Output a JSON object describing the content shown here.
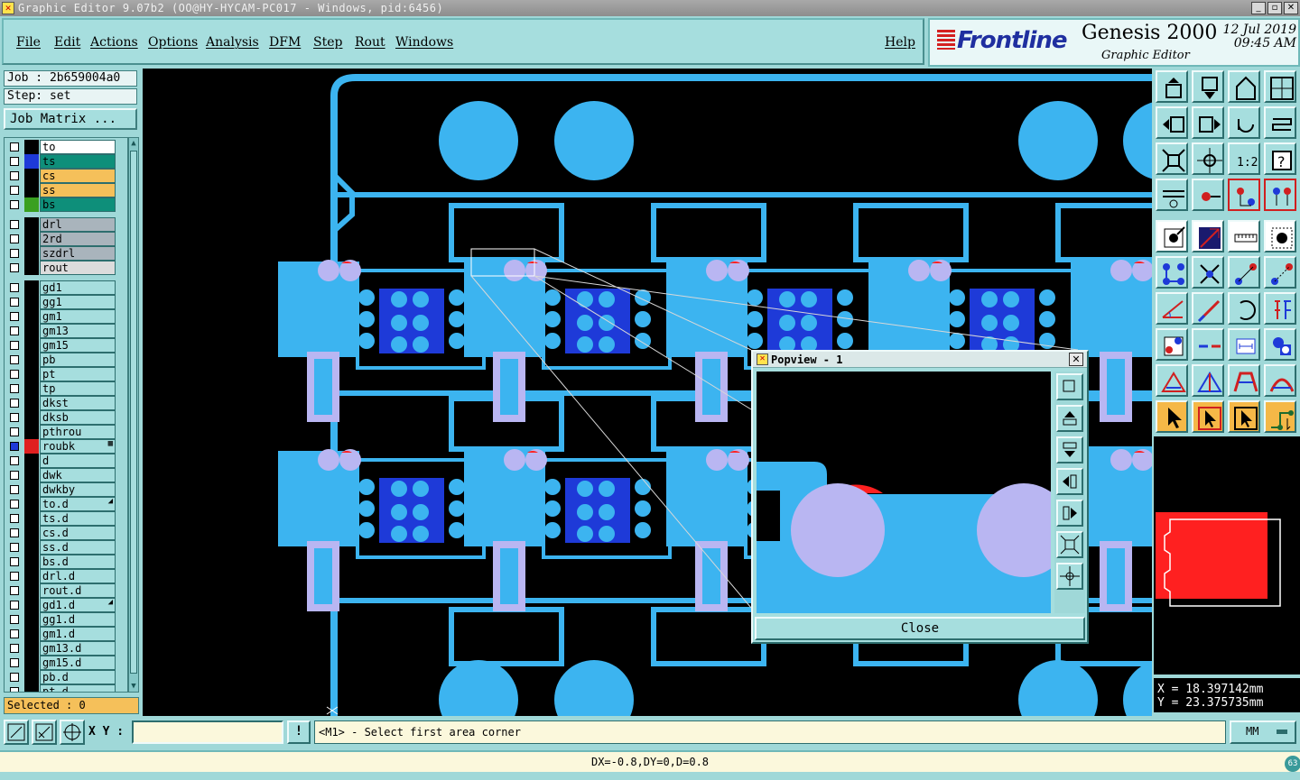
{
  "window": {
    "title": "Graphic Editor 9.07b2 (OO@HY-HYCAM-PC017 - Windows, pid:6456)"
  },
  "menu": {
    "file": "File",
    "edit": "Edit",
    "actions": "Actions",
    "options": "Options",
    "analysis": "Analysis",
    "dfm": "DFM",
    "step": "Step",
    "rout": "Rout",
    "windows": "Windows",
    "help": "Help"
  },
  "brand": {
    "logo": "Frontline",
    "product": "Genesis 2000",
    "subtitle": "Graphic Editor",
    "date": "12 Jul 2019",
    "time": "09:45 AM"
  },
  "job": {
    "job_label": "Job : 2b659004a0",
    "step_label": "Step: set",
    "matrix_button": "Job Matrix ..."
  },
  "layers": [
    {
      "name": "to",
      "color": "#ffffff",
      "swatch": "#000000"
    },
    {
      "name": "ts",
      "color": "#0e8f7a",
      "swatch": "#1e3ad8"
    },
    {
      "name": "cs",
      "color": "#f5c05a",
      "swatch": "#000000"
    },
    {
      "name": "ss",
      "color": "#f5c05a",
      "swatch": "#000000"
    },
    {
      "name": "bs",
      "color": "#0e8f7a",
      "swatch": "#3aa020"
    },
    {
      "name": "drl",
      "color": "#a9b4bc",
      "swatch": "#000000"
    },
    {
      "name": "2rd",
      "color": "#a9b4bc",
      "swatch": "#000000"
    },
    {
      "name": "szdrl",
      "color": "#a9b4bc",
      "swatch": "#000000"
    },
    {
      "name": "rout",
      "color": "#dcdcdc",
      "swatch": "#000000"
    },
    {
      "name": "gd1",
      "color": "#a6dede",
      "swatch": "#000000"
    },
    {
      "name": "gg1",
      "color": "#a6dede",
      "swatch": "#000000"
    },
    {
      "name": "gm1",
      "color": "#a6dede",
      "swatch": "#000000"
    },
    {
      "name": "gm13",
      "color": "#a6dede",
      "swatch": "#000000"
    },
    {
      "name": "gm15",
      "color": "#a6dede",
      "swatch": "#000000"
    },
    {
      "name": "pb",
      "color": "#a6dede",
      "swatch": "#000000"
    },
    {
      "name": "pt",
      "color": "#a6dede",
      "swatch": "#000000"
    },
    {
      "name": "tp",
      "color": "#a6dede",
      "swatch": "#000000"
    },
    {
      "name": "dkst",
      "color": "#a6dede",
      "swatch": "#000000"
    },
    {
      "name": "dksb",
      "color": "#a6dede",
      "swatch": "#000000"
    },
    {
      "name": "pthrou",
      "color": "#a6dede",
      "swatch": "#000000"
    },
    {
      "name": "roubk",
      "color": "#a6dede",
      "swatch": "#e02020",
      "active": true,
      "mark": "▦"
    },
    {
      "name": "d",
      "color": "#a6dede",
      "swatch": "#000000"
    },
    {
      "name": "dwk",
      "color": "#a6dede",
      "swatch": "#000000"
    },
    {
      "name": "dwkby",
      "color": "#a6dede",
      "swatch": "#000000"
    },
    {
      "name": "to.d",
      "color": "#a6dede",
      "swatch": "#000000",
      "mark": "◢"
    },
    {
      "name": "ts.d",
      "color": "#a6dede",
      "swatch": "#000000"
    },
    {
      "name": "cs.d",
      "color": "#a6dede",
      "swatch": "#000000"
    },
    {
      "name": "ss.d",
      "color": "#a6dede",
      "swatch": "#000000"
    },
    {
      "name": "bs.d",
      "color": "#a6dede",
      "swatch": "#000000"
    },
    {
      "name": "drl.d",
      "color": "#a6dede",
      "swatch": "#000000"
    },
    {
      "name": "rout.d",
      "color": "#a6dede",
      "swatch": "#000000"
    },
    {
      "name": "gd1.d",
      "color": "#a6dede",
      "swatch": "#000000",
      "mark": "◢"
    },
    {
      "name": "gg1.d",
      "color": "#a6dede",
      "swatch": "#000000"
    },
    {
      "name": "gm1.d",
      "color": "#a6dede",
      "swatch": "#000000"
    },
    {
      "name": "gm13.d",
      "color": "#a6dede",
      "swatch": "#000000"
    },
    {
      "name": "gm15.d",
      "color": "#a6dede",
      "swatch": "#000000"
    },
    {
      "name": "pb.d",
      "color": "#a6dede",
      "swatch": "#000000"
    },
    {
      "name": "pt.d",
      "color": "#a6dede",
      "swatch": "#000000"
    }
  ],
  "selected": "Selected : 0",
  "coords": {
    "x": "X = 18.397142mm",
    "y": "Y = 23.375735mm"
  },
  "bottom": {
    "xy_label": "X Y :",
    "xy_value": "",
    "warn": "!",
    "prompt": "<M1> - Select first area corner",
    "units": "MM"
  },
  "status": {
    "text": "DX=-0.8,DY=0,D=0.8",
    "badge": "63"
  },
  "popview": {
    "title": "Popview - 1",
    "close": "Close"
  },
  "colors": {
    "copper": "#3cb4f0",
    "pad_dark": "#1e3ad8",
    "drill": "#b9b6f2",
    "route_red": "#ff2020",
    "panel_bg": "#9fd8d8"
  }
}
